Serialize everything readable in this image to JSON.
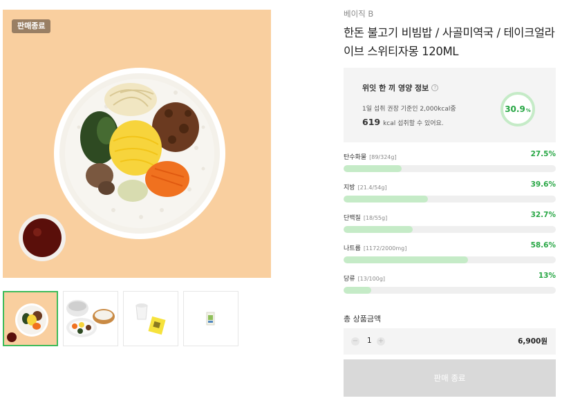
{
  "gallery": {
    "badge": "판매종료",
    "thumbnails": [
      {
        "name": "bibimbap-bowl",
        "active": true
      },
      {
        "name": "meal-set-containers",
        "active": false
      },
      {
        "name": "cup-and-sauce-pack",
        "active": false
      },
      {
        "name": "drink-pack",
        "active": false
      }
    ]
  },
  "product": {
    "brand": "베이직 B",
    "title": "한돈 불고기 비빔밥 / 사골미역국 / 테이크얼라이브 스위티자몽 120ML"
  },
  "nutrition": {
    "title": "위잇 한 끼 영양 정보",
    "help_icon": "?",
    "daily_note": "1일 섭취 권장 기준인 2,000kcal중",
    "kcal_value": "619",
    "kcal_suffix": "kcal 섭취할 수 있어요.",
    "ring_value": "30.9",
    "ring_unit": "%",
    "ring_fraction": 0.309,
    "accent_color": "#27a644",
    "ring_color": "#c5ebc7",
    "items": [
      {
        "label": "탄수화물",
        "detail": "[89/324g]",
        "percent": "27.5%",
        "value": 27.5
      },
      {
        "label": "지방",
        "detail": "[21.4/54g]",
        "percent": "39.6%",
        "value": 39.6
      },
      {
        "label": "단백질",
        "detail": "[18/55g]",
        "percent": "32.7%",
        "value": 32.7
      },
      {
        "label": "나트륨",
        "detail": "[1172/2000mg]",
        "percent": "58.6%",
        "value": 58.6
      },
      {
        "label": "당류",
        "detail": "[13/100g]",
        "percent": "13%",
        "value": 13
      }
    ]
  },
  "order": {
    "total_label": "총 상품금액",
    "quantity": "1",
    "minus_symbol": "−",
    "plus_symbol": "+",
    "price": "6,900원",
    "buy_button": "판매 종료"
  }
}
